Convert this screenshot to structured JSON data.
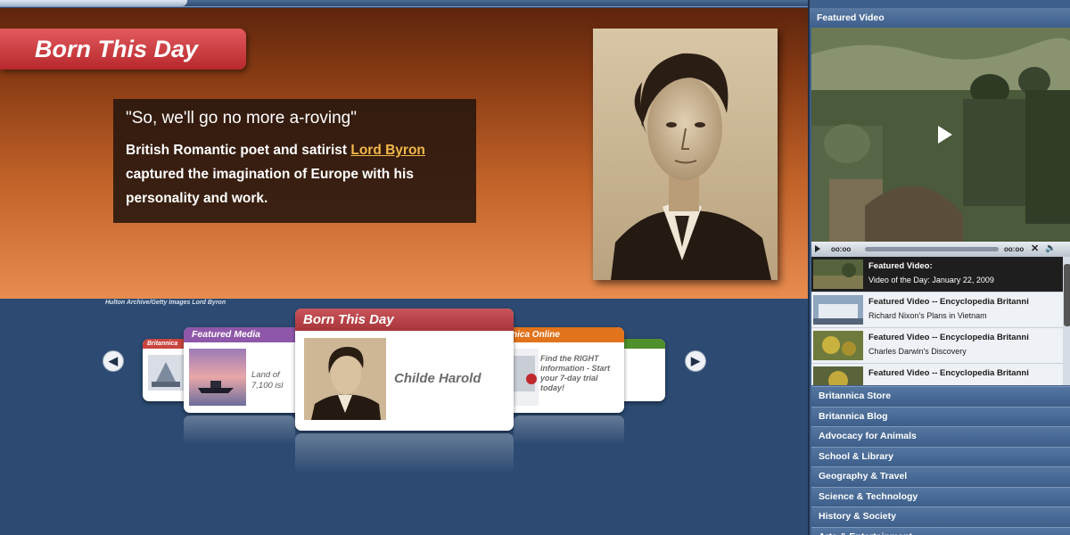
{
  "hero": {
    "tag_label": "Born This Day",
    "quote_title": "\"So, we'll go no more a-roving\"",
    "body_pre": "British Romantic poet and satirist ",
    "body_link": "Lord Byron",
    "body_post": " captured the imagination of Europe with his personality and work.",
    "photo_credit": "Hulton Archive/Getty Images Lord Byron"
  },
  "carousel": {
    "prev_icon": "◀",
    "next_icon": "▶",
    "cards": [
      {
        "header": "Britannica",
        "color": "#c8453f"
      },
      {
        "header": "Featured Media",
        "color": "#8f57a9",
        "text": "Land of 7,100 isl"
      },
      {
        "header": "Born This Day",
        "color": "#b8383a",
        "text": "Childe Harold"
      },
      {
        "header": "nica Online",
        "color": "#e0731c",
        "text": "Find the RIGHT information - Start your 7-day trial today!"
      },
      {
        "header": "",
        "color": "#4f8f2c"
      }
    ]
  },
  "sidebar": {
    "featured_title": "Featured Video",
    "player": {
      "time_start": "oo:oo",
      "time_end": "oo:oo",
      "close_icon": "✕",
      "volume_icon": "🔈"
    },
    "videos": [
      {
        "title": "Featured Video:",
        "subtitle": "Video of the Day: January 22, 2009",
        "active": true
      },
      {
        "title": "Featured Video -- Encyclopedia Britanni",
        "subtitle": "Richard Nixon's Plans in Vietnam",
        "active": false
      },
      {
        "title": "Featured Video -- Encyclopedia Britanni",
        "subtitle": "Charles Darwin's Discovery",
        "active": false
      },
      {
        "title": "Featured Video -- Encyclopedia Britanni",
        "subtitle": "",
        "active": false
      }
    ],
    "links": [
      "Britannica Store",
      "Britannica Blog",
      "Advocacy for Animals",
      "School & Library",
      "Geography & Travel",
      "Science & Technology",
      "History & Society",
      "Arts & Entertainment"
    ]
  },
  "colors": {
    "hero_dark": "#5e250d",
    "hero_light": "#e88c50",
    "tag_red": "#c0393d",
    "link_gold": "#f2b84a",
    "sidebar_blue": "#3e5f8a"
  }
}
